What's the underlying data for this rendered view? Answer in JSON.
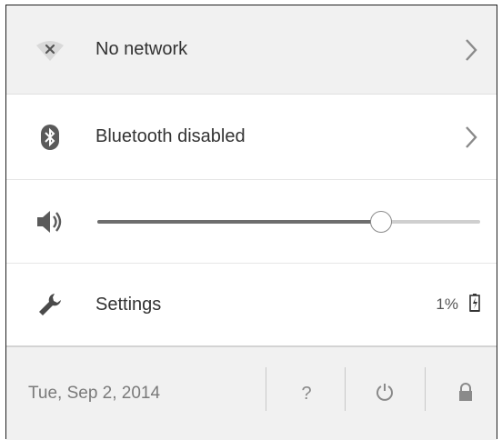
{
  "network": {
    "label": "No network",
    "icon": "wifi-x-icon"
  },
  "bluetooth": {
    "label": "Bluetooth disabled",
    "icon": "bluetooth-icon"
  },
  "volume": {
    "icon": "speaker-icon",
    "level_percent": 74
  },
  "settings": {
    "label": "Settings",
    "icon": "wrench-icon",
    "battery_percent": "1%",
    "battery_icon": "battery-charging-icon"
  },
  "footer": {
    "date": "Tue, Sep 2, 2014",
    "help_label": "?",
    "power_icon": "power-icon",
    "lock_icon": "lock-icon"
  },
  "colors": {
    "row_gray": "#f1f1f1",
    "text": "#333333",
    "muted": "#7a7a7a"
  }
}
